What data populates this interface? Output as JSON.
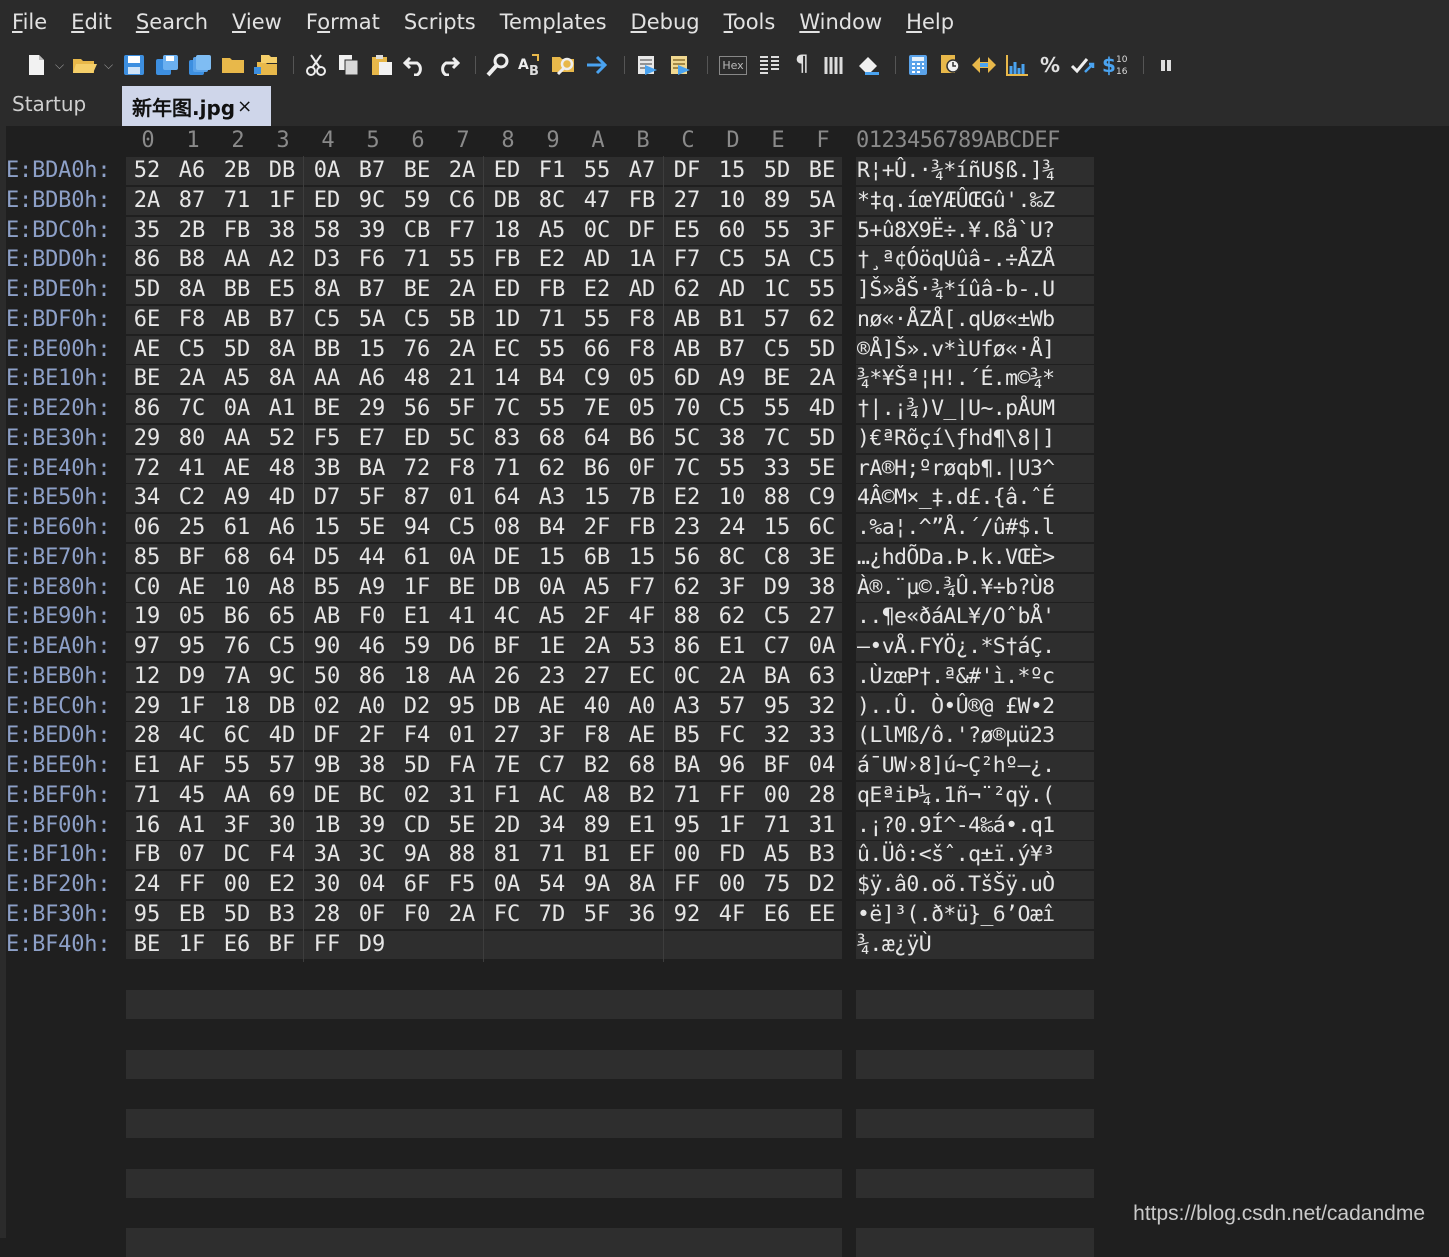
{
  "menu": [
    {
      "label": "File",
      "u": "F"
    },
    {
      "label": "Edit",
      "u": "E"
    },
    {
      "label": "Search",
      "u": "S"
    },
    {
      "label": "View",
      "u": "V"
    },
    {
      "label": "Format",
      "u": "o"
    },
    {
      "label": "Scripts",
      "u": ""
    },
    {
      "label": "Templates",
      "u": "l"
    },
    {
      "label": "Debug",
      "u": "D"
    },
    {
      "label": "Tools",
      "u": "T"
    },
    {
      "label": "Window",
      "u": "W"
    },
    {
      "label": "Help",
      "u": "H"
    }
  ],
  "toolbar": {
    "hex_label": "Hex",
    "icons": [
      "new-file-icon",
      "open-folder-icon",
      "save-icon",
      "save-as-icon",
      "save-all-icon",
      "folder-icon",
      "open-workspace-icon",
      "cut-icon",
      "copy-icon",
      "paste-icon",
      "undo-icon",
      "redo-icon",
      "find-icon",
      "find-replace-icon",
      "find-in-files-icon",
      "goto-icon",
      "run-script-icon",
      "run-template-icon",
      "hex-mode-icon",
      "column-mode-icon",
      "pilcrow-icon",
      "columns-icon",
      "highlight-icon",
      "calculator-icon",
      "inspector-icon",
      "compare-icon",
      "histogram-icon",
      "percent-icon",
      "checksum-icon",
      "base-convert-icon",
      "pause-icon"
    ]
  },
  "tabs": {
    "startup": "Startup",
    "active": "新年图.jpg",
    "close": "×"
  },
  "header": {
    "columns": [
      "0",
      "1",
      "2",
      "3",
      "4",
      "5",
      "6",
      "7",
      "8",
      "9",
      "A",
      "B",
      "C",
      "D",
      "E",
      "F"
    ],
    "ascii": "0123456789ABCDEF"
  },
  "rows": [
    {
      "addr": "E:BDA0h:",
      "bytes": [
        "52",
        "A6",
        "2B",
        "DB",
        "0A",
        "B7",
        "BE",
        "2A",
        "ED",
        "F1",
        "55",
        "A7",
        "DF",
        "15",
        "5D",
        "BE"
      ],
      "ascii": "R¦+Û.·¾*íñU§ß.]¾"
    },
    {
      "addr": "E:BDB0h:",
      "bytes": [
        "2A",
        "87",
        "71",
        "1F",
        "ED",
        "9C",
        "59",
        "C6",
        "DB",
        "8C",
        "47",
        "FB",
        "27",
        "10",
        "89",
        "5A"
      ],
      "ascii": "*‡q.íœYÆÛŒGû'.‰Z"
    },
    {
      "addr": "E:BDC0h:",
      "bytes": [
        "35",
        "2B",
        "FB",
        "38",
        "58",
        "39",
        "CB",
        "F7",
        "18",
        "A5",
        "0C",
        "DF",
        "E5",
        "60",
        "55",
        "3F"
      ],
      "ascii": "5+û8X9Ë÷.¥.ßå`U?"
    },
    {
      "addr": "E:BDD0h:",
      "bytes": [
        "86",
        "B8",
        "AA",
        "A2",
        "D3",
        "F6",
        "71",
        "55",
        "FB",
        "E2",
        "AD",
        "1A",
        "F7",
        "C5",
        "5A",
        "C5"
      ],
      "ascii": "†¸ª¢ÓöqUûâ-.÷ÅZÅ"
    },
    {
      "addr": "E:BDE0h:",
      "bytes": [
        "5D",
        "8A",
        "BB",
        "E5",
        "8A",
        "B7",
        "BE",
        "2A",
        "ED",
        "FB",
        "E2",
        "AD",
        "62",
        "AD",
        "1C",
        "55"
      ],
      "ascii": "]Š»åŠ·¾*íûâ-b-.U"
    },
    {
      "addr": "E:BDF0h:",
      "bytes": [
        "6E",
        "F8",
        "AB",
        "B7",
        "C5",
        "5A",
        "C5",
        "5B",
        "1D",
        "71",
        "55",
        "F8",
        "AB",
        "B1",
        "57",
        "62"
      ],
      "ascii": "nø«·ÅZÅ[.qUø«±Wb"
    },
    {
      "addr": "E:BE00h:",
      "bytes": [
        "AE",
        "C5",
        "5D",
        "8A",
        "BB",
        "15",
        "76",
        "2A",
        "EC",
        "55",
        "66",
        "F8",
        "AB",
        "B7",
        "C5",
        "5D"
      ],
      "ascii": "®Å]Š».v*ìUfø«·Å]"
    },
    {
      "addr": "E:BE10h:",
      "bytes": [
        "BE",
        "2A",
        "A5",
        "8A",
        "AA",
        "A6",
        "48",
        "21",
        "14",
        "B4",
        "C9",
        "05",
        "6D",
        "A9",
        "BE",
        "2A"
      ],
      "ascii": "¾*¥Šª¦H!.´É.m©¾*"
    },
    {
      "addr": "E:BE20h:",
      "bytes": [
        "86",
        "7C",
        "0A",
        "A1",
        "BE",
        "29",
        "56",
        "5F",
        "7C",
        "55",
        "7E",
        "05",
        "70",
        "C5",
        "55",
        "4D"
      ],
      "ascii": "†|.¡¾)V_|U~.pÅUM"
    },
    {
      "addr": "E:BE30h:",
      "bytes": [
        "29",
        "80",
        "AA",
        "52",
        "F5",
        "E7",
        "ED",
        "5C",
        "83",
        "68",
        "64",
        "B6",
        "5C",
        "38",
        "7C",
        "5D"
      ],
      "ascii": ")€ªRõçí\\ƒhd¶\\8|]"
    },
    {
      "addr": "E:BE40h:",
      "bytes": [
        "72",
        "41",
        "AE",
        "48",
        "3B",
        "BA",
        "72",
        "F8",
        "71",
        "62",
        "B6",
        "0F",
        "7C",
        "55",
        "33",
        "5E"
      ],
      "ascii": "rA®H;ºrøqb¶.|U3^"
    },
    {
      "addr": "E:BE50h:",
      "bytes": [
        "34",
        "C2",
        "A9",
        "4D",
        "D7",
        "5F",
        "87",
        "01",
        "64",
        "A3",
        "15",
        "7B",
        "E2",
        "10",
        "88",
        "C9"
      ],
      "ascii": "4Â©M×_‡.d£.{â.ˆÉ"
    },
    {
      "addr": "E:BE60h:",
      "bytes": [
        "06",
        "25",
        "61",
        "A6",
        "15",
        "5E",
        "94",
        "C5",
        "08",
        "B4",
        "2F",
        "FB",
        "23",
        "24",
        "15",
        "6C"
      ],
      "ascii": ".%a¦.^”Å.´/û#$.l"
    },
    {
      "addr": "E:BE70h:",
      "bytes": [
        "85",
        "BF",
        "68",
        "64",
        "D5",
        "44",
        "61",
        "0A",
        "DE",
        "15",
        "6B",
        "15",
        "56",
        "8C",
        "C8",
        "3E"
      ],
      "ascii": "…¿hdÕDa.Þ.k.VŒÈ>"
    },
    {
      "addr": "E:BE80h:",
      "bytes": [
        "C0",
        "AE",
        "10",
        "A8",
        "B5",
        "A9",
        "1F",
        "BE",
        "DB",
        "0A",
        "A5",
        "F7",
        "62",
        "3F",
        "D9",
        "38"
      ],
      "ascii": "À®.¨µ©.¾Û.¥÷b?Ù8"
    },
    {
      "addr": "E:BE90h:",
      "bytes": [
        "19",
        "05",
        "B6",
        "65",
        "AB",
        "F0",
        "E1",
        "41",
        "4C",
        "A5",
        "2F",
        "4F",
        "88",
        "62",
        "C5",
        "27"
      ],
      "ascii": "..¶e«ðáAL¥/OˆbÅ'"
    },
    {
      "addr": "E:BEA0h:",
      "bytes": [
        "97",
        "95",
        "76",
        "C5",
        "90",
        "46",
        "59",
        "D6",
        "BF",
        "1E",
        "2A",
        "53",
        "86",
        "E1",
        "C7",
        "0A"
      ],
      "ascii": "—•vÅ.FYÖ¿.*S†áÇ."
    },
    {
      "addr": "E:BEB0h:",
      "bytes": [
        "12",
        "D9",
        "7A",
        "9C",
        "50",
        "86",
        "18",
        "AA",
        "26",
        "23",
        "27",
        "EC",
        "0C",
        "2A",
        "BA",
        "63"
      ],
      "ascii": ".ÙzœP†.ª&#'ì.*ºc"
    },
    {
      "addr": "E:BEC0h:",
      "bytes": [
        "29",
        "1F",
        "18",
        "DB",
        "02",
        "A0",
        "D2",
        "95",
        "DB",
        "AE",
        "40",
        "A0",
        "A3",
        "57",
        "95",
        "32"
      ],
      "ascii": ")..Û. Ò•Û®@ £W•2"
    },
    {
      "addr": "E:BED0h:",
      "bytes": [
        "28",
        "4C",
        "6C",
        "4D",
        "DF",
        "2F",
        "F4",
        "01",
        "27",
        "3F",
        "F8",
        "AE",
        "B5",
        "FC",
        "32",
        "33"
      ],
      "ascii": "(LlMß/ô.'?ø®µü23"
    },
    {
      "addr": "E:BEE0h:",
      "bytes": [
        "E1",
        "AF",
        "55",
        "57",
        "9B",
        "38",
        "5D",
        "FA",
        "7E",
        "C7",
        "B2",
        "68",
        "BA",
        "96",
        "BF",
        "04"
      ],
      "ascii": "á¯UW›8]ú~Ç²hº–¿."
    },
    {
      "addr": "E:BEF0h:",
      "bytes": [
        "71",
        "45",
        "AA",
        "69",
        "DE",
        "BC",
        "02",
        "31",
        "F1",
        "AC",
        "A8",
        "B2",
        "71",
        "FF",
        "00",
        "28"
      ],
      "ascii": "qEªiÞ¼.1ñ¬¨²qÿ.("
    },
    {
      "addr": "E:BF00h:",
      "bytes": [
        "16",
        "A1",
        "3F",
        "30",
        "1B",
        "39",
        "CD",
        "5E",
        "2D",
        "34",
        "89",
        "E1",
        "95",
        "1F",
        "71",
        "31"
      ],
      "ascii": ".¡?0.9Í^-4‰á•.q1"
    },
    {
      "addr": "E:BF10h:",
      "bytes": [
        "FB",
        "07",
        "DC",
        "F4",
        "3A",
        "3C",
        "9A",
        "88",
        "81",
        "71",
        "B1",
        "EF",
        "00",
        "FD",
        "A5",
        "B3"
      ],
      "ascii": "û.Üô:<šˆ.q±ï.ý¥³"
    },
    {
      "addr": "E:BF20h:",
      "bytes": [
        "24",
        "FF",
        "00",
        "E2",
        "30",
        "04",
        "6F",
        "F5",
        "0A",
        "54",
        "9A",
        "8A",
        "FF",
        "00",
        "75",
        "D2"
      ],
      "ascii": "$ÿ.â0.oõ.TšŠÿ.uÒ"
    },
    {
      "addr": "E:BF30h:",
      "bytes": [
        "95",
        "EB",
        "5D",
        "B3",
        "28",
        "0F",
        "F0",
        "2A",
        "FC",
        "7D",
        "5F",
        "36",
        "92",
        "4F",
        "E6",
        "EE"
      ],
      "ascii": "•ë]³(.ð*ü}_6’Oæî"
    },
    {
      "addr": "E:BF40h:",
      "bytes": [
        "BE",
        "1F",
        "E6",
        "BF",
        "FF",
        "D9"
      ],
      "ascii": "¾.æ¿ÿÙ"
    }
  ],
  "watermark": "https://blog.csdn.net/cadandme"
}
